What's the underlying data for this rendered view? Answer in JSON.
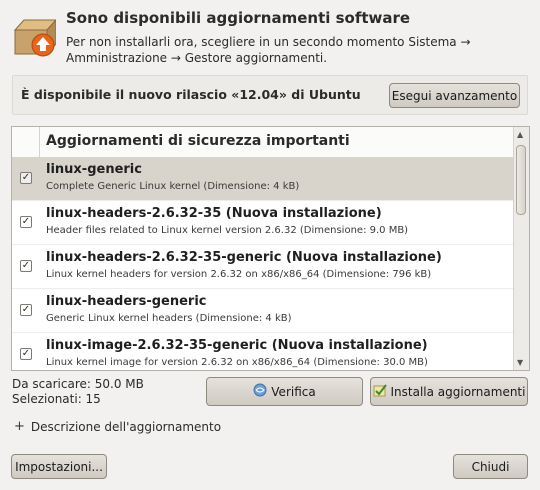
{
  "header": {
    "icon": "package-update-icon",
    "title": "Sono disponibili aggiornamenti software",
    "subtitle": "Per non installarli ora, scegliere in un secondo momento Sistema → Amministrazione → Gestore aggiornamenti."
  },
  "release_banner": {
    "text": "È disponibile il nuovo rilascio «12.04» di Ubuntu",
    "button_label": "Esegui avanzamento"
  },
  "update_list": {
    "header": "Aggiornamenti di sicurezza importanti",
    "items": [
      {
        "name": "linux-generic",
        "description": "Complete Generic Linux kernel (Dimensione: 4 kB)",
        "checked": true,
        "selected": true
      },
      {
        "name": "linux-headers-2.6.32-35 (Nuova installazione)",
        "description": "Header files related to Linux kernel version 2.6.32 (Dimensione: 9.0 MB)",
        "checked": true,
        "selected": false
      },
      {
        "name": "linux-headers-2.6.32-35-generic (Nuova installazione)",
        "description": "Linux kernel headers for version 2.6.32 on x86/x86_64 (Dimensione: 796 kB)",
        "checked": true,
        "selected": false
      },
      {
        "name": "linux-headers-generic",
        "description": "Generic Linux kernel headers (Dimensione: 4 kB)",
        "checked": true,
        "selected": false
      },
      {
        "name": "linux-image-2.6.32-35-generic (Nuova installazione)",
        "description": "Linux kernel image for version 2.6.32 on x86/x86_64 (Dimensione: 30.0 MB)",
        "checked": true,
        "selected": false
      }
    ]
  },
  "status": {
    "download_size": "Da scaricare: 50.0 MB",
    "selected_count": "Selezionati: 15"
  },
  "buttons": {
    "verify": "Verifica",
    "install": "Installa aggiornamenti",
    "settings": "Impostazioni...",
    "close": "Chiudi"
  },
  "expander": {
    "label": "Descrizione dell'aggiornamento",
    "icon": "expand-plus-icon"
  },
  "colors": {
    "selected_row": "#d8d3cb",
    "window_bg": "#f2f1f0"
  }
}
